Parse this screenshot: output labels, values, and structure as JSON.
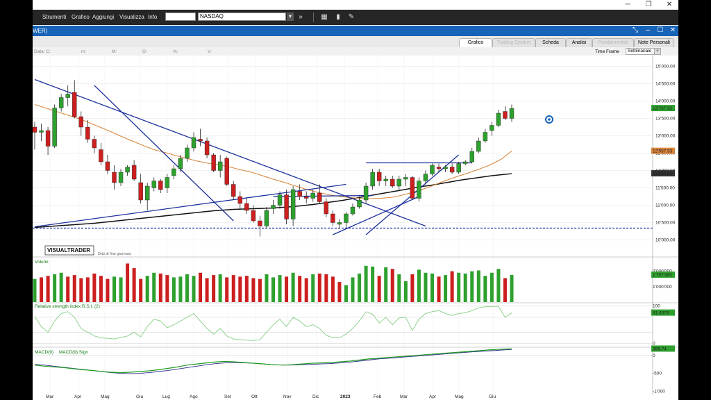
{
  "menubar": {
    "items": [
      "Strumenti",
      "Grafico",
      "Aggiungi",
      "Visualizza",
      "Info"
    ],
    "underline": [
      "S",
      "G",
      "A",
      "V",
      "I"
    ]
  },
  "toolbar": {
    "symbol": "NASDAQ",
    "icons": [
      "dropdown-arrow-icon",
      "fast-forward-icon",
      "grid-icon",
      "bar-chart-icon",
      "tools-icon"
    ]
  },
  "window": {
    "title_fragment": "WER)",
    "controls": [
      "resize-icon",
      "minimize-icon",
      "maximize-icon",
      "close-icon"
    ]
  },
  "tabs": [
    {
      "label": "Grafico",
      "state": "active"
    },
    {
      "label": "Trading System",
      "state": "disabled"
    },
    {
      "label": "Scheda",
      "state": "normal"
    },
    {
      "label": "Analisi",
      "state": "normal"
    },
    {
      "label": "Fondamentali",
      "state": "disabled"
    },
    {
      "label": "Note Personali",
      "state": "normal"
    }
  ],
  "info_row": {
    "labels": [
      "Data: C:",
      "m:",
      "M:",
      "O:",
      "%:",
      "V:"
    ],
    "timeframe_label": "Time Frame",
    "timeframe_value": "Settimanale"
  },
  "brand": {
    "logo": "VISUALTRADER",
    "note": "Dati di fine giornata"
  },
  "colors": {
    "up": "#2ea02e",
    "down": "#cc1f1f",
    "trendline": "#1c2f9c",
    "ma_short": "#d9853b",
    "ma_long": "#111111",
    "rsi": "#8fd28f",
    "accent_blue": "#1763b8"
  },
  "chart_data": [
    {
      "type": "candlestick",
      "name": "price",
      "x": [
        "Mar",
        "Apr",
        "Mag",
        "Giu",
        "Lug",
        "Ago",
        "Set",
        "Ott",
        "Nov",
        "Dic",
        "2023",
        "Feb",
        "Mar",
        "Apr",
        "Mag",
        "Giu"
      ],
      "yticks": [
        "15'000.00",
        "14'500.00",
        "14'000.00",
        "13'500.00",
        "13'000.00",
        "12'500.00",
        "12'000.00",
        "11'500.00",
        "11'000.00",
        "10'500.00",
        "10'000.00"
      ],
      "ylim": [
        9950,
        15150
      ],
      "last_label": "13'787.92",
      "ma_short_label": "12'557.53",
      "ma_long_label": "11'909.82",
      "support_level": 10340,
      "candles": [
        [
          13250,
          13400,
          12600,
          13100
        ],
        [
          13100,
          13350,
          12850,
          13150
        ],
        [
          13150,
          13250,
          12450,
          12700
        ],
        [
          12700,
          13900,
          12650,
          13800
        ],
        [
          13800,
          14200,
          13700,
          14100
        ],
        [
          14100,
          14450,
          13850,
          14200
        ],
        [
          14250,
          14600,
          13500,
          13550
        ],
        [
          13550,
          13700,
          13000,
          13250
        ],
        [
          13250,
          13450,
          12800,
          12900
        ],
        [
          12900,
          13000,
          12500,
          12650
        ],
        [
          12600,
          12800,
          12150,
          12250
        ],
        [
          12250,
          12450,
          11900,
          12000
        ],
        [
          11950,
          12150,
          11450,
          11650
        ],
        [
          11650,
          12050,
          11550,
          11950
        ],
        [
          11950,
          12150,
          11850,
          12100
        ],
        [
          12150,
          12300,
          11700,
          11750
        ],
        [
          11650,
          11900,
          11050,
          11150
        ],
        [
          11150,
          11650,
          10850,
          11550
        ],
        [
          11500,
          11800,
          11400,
          11700
        ],
        [
          11700,
          11750,
          11350,
          11450
        ],
        [
          11500,
          11900,
          11350,
          11800
        ],
        [
          11850,
          12150,
          11750,
          12050
        ],
        [
          12050,
          12450,
          11950,
          12350
        ],
        [
          12350,
          12750,
          12250,
          12650
        ],
        [
          12650,
          13100,
          12550,
          12950
        ],
        [
          12900,
          13200,
          12700,
          12850
        ],
        [
          12850,
          12950,
          12350,
          12450
        ],
        [
          12450,
          12500,
          11950,
          12000
        ],
        [
          12000,
          12450,
          11800,
          12250
        ],
        [
          12350,
          12400,
          11550,
          11600
        ],
        [
          11600,
          11700,
          11150,
          11250
        ],
        [
          11250,
          11400,
          10900,
          11050
        ],
        [
          11050,
          11200,
          10750,
          10850
        ],
        [
          10850,
          11000,
          10500,
          10550
        ],
        [
          10550,
          10700,
          10100,
          10400
        ],
        [
          10400,
          10950,
          10350,
          10850
        ],
        [
          10900,
          11150,
          10750,
          11000
        ],
        [
          11000,
          11400,
          10900,
          11300
        ],
        [
          11300,
          11450,
          10450,
          10600
        ],
        [
          10600,
          11550,
          10400,
          11450
        ],
        [
          11400,
          11600,
          11150,
          11250
        ],
        [
          11250,
          11400,
          11050,
          11200
        ],
        [
          11200,
          11450,
          11100,
          11350
        ],
        [
          11350,
          11600,
          11050,
          11100
        ],
        [
          11100,
          11200,
          10650,
          10750
        ],
        [
          10750,
          10850,
          10400,
          10500
        ],
        [
          10450,
          10600,
          10350,
          10500
        ],
        [
          10500,
          10800,
          10350,
          10750
        ],
        [
          10750,
          11050,
          10700,
          10950
        ],
        [
          10950,
          11250,
          10900,
          11150
        ],
        [
          11150,
          11650,
          11050,
          11550
        ],
        [
          11550,
          12050,
          11450,
          11950
        ],
        [
          11950,
          12050,
          11550,
          11700
        ],
        [
          11700,
          11850,
          11550,
          11750
        ],
        [
          11750,
          11850,
          11500,
          11550
        ],
        [
          11550,
          11850,
          11450,
          11750
        ],
        [
          11750,
          11900,
          11550,
          11800
        ],
        [
          11800,
          11850,
          11150,
          11200
        ],
        [
          11200,
          11800,
          11100,
          11700
        ],
        [
          11700,
          12000,
          11600,
          11900
        ],
        [
          11900,
          12200,
          11850,
          12150
        ],
        [
          12100,
          12200,
          11950,
          12050
        ],
        [
          12050,
          12150,
          11950,
          12100
        ],
        [
          12100,
          12200,
          11900,
          11950
        ],
        [
          11950,
          12250,
          11900,
          12200
        ],
        [
          12200,
          12300,
          12150,
          12250
        ],
        [
          12250,
          12650,
          12200,
          12550
        ],
        [
          12550,
          12950,
          12500,
          12850
        ],
        [
          12850,
          13200,
          12800,
          13100
        ],
        [
          13150,
          13400,
          13000,
          13300
        ],
        [
          13300,
          13750,
          13250,
          13650
        ],
        [
          13700,
          13850,
          13450,
          13500
        ],
        [
          13500,
          13900,
          13400,
          13788
        ]
      ],
      "ma_short": [
        13900,
        13800,
        13700,
        13600,
        13500,
        13380,
        13250,
        13120,
        12980,
        12850,
        12720,
        12600,
        12520,
        12430,
        12350,
        12270,
        12210,
        12160,
        12100,
        12020,
        11950,
        11850,
        11750,
        11660,
        11560,
        11460,
        11380,
        11310,
        11260,
        11220,
        11200,
        11190,
        11200,
        11230,
        11300,
        11380,
        11480,
        11600,
        11720,
        11830,
        11930,
        12040,
        12160,
        12320,
        12557
      ],
      "ma_long": [
        10360,
        10380,
        10400,
        10420,
        10440,
        10460,
        10480,
        10510,
        10540,
        10570,
        10600,
        10630,
        10660,
        10690,
        10720,
        10750,
        10780,
        10810,
        10840,
        10860,
        10880,
        10890,
        10900,
        10910,
        10920,
        10940,
        10960,
        10990,
        11020,
        11060,
        11100,
        11140,
        11190,
        11240,
        11290,
        11340,
        11390,
        11440,
        11490,
        11540,
        11580,
        11630,
        11680,
        11730,
        11770,
        11810,
        11850,
        11880,
        11909
      ]
    },
    {
      "type": "bar",
      "name": "Volumi",
      "ylim": [
        0,
        2700000
      ],
      "yticks": [
        "2'000'000",
        "1'000'000"
      ],
      "last_label": "1'757'300",
      "values": [
        1500000,
        1600000,
        1700000,
        1800000,
        1900000,
        1650000,
        1750000,
        1550000,
        1600000,
        1850000,
        1700000,
        1500000,
        1650000,
        1600000,
        2500000,
        2200000,
        1500000,
        1700000,
        1900000,
        1850000,
        1750000,
        1600000,
        1650000,
        1800000,
        1700000,
        1900000,
        1550000,
        1750000,
        1800000,
        1600000,
        1750000,
        1650000,
        1700000,
        1550000,
        1500000,
        1800000,
        1600000,
        1750000,
        1650000,
        1900000,
        1700000,
        1550000,
        1800000,
        1850000,
        1800000,
        1650000,
        1300000,
        1100000,
        1600000,
        1850000,
        2350000,
        2300000,
        1700000,
        2250000,
        2150000,
        1800000,
        1350000,
        1800000,
        2100000,
        1900000,
        1850000,
        1650000,
        1750000,
        2000000,
        1900000,
        1850000,
        2000000,
        2050000,
        1700000,
        1900000,
        2150000,
        1550000,
        1757300
      ],
      "colors_up": [
        1,
        0,
        0,
        1,
        1,
        0,
        0,
        0,
        0,
        0,
        0,
        0,
        1,
        1,
        0,
        0,
        0,
        1,
        1,
        0,
        0,
        1,
        1,
        1,
        1,
        0,
        0,
        0,
        1,
        0,
        0,
        0,
        0,
        0,
        0,
        1,
        1,
        1,
        0,
        1,
        0,
        0,
        1,
        0,
        0,
        0,
        0,
        1,
        1,
        1,
        1,
        1,
        0,
        1,
        0,
        1,
        1,
        0,
        1,
        1,
        1,
        0,
        1,
        0,
        1,
        1,
        1,
        1,
        1,
        1,
        1,
        0,
        1
      ]
    },
    {
      "type": "line",
      "name": "Relative strength index R.S.I. (2)",
      "ylim": [
        -10,
        105
      ],
      "yticks": [
        "100",
        "0",
        "-0"
      ],
      "last_label": "81.6378",
      "values": [
        72,
        45,
        30,
        60,
        80,
        85,
        70,
        40,
        30,
        20,
        15,
        14,
        12,
        16,
        20,
        30,
        18,
        45,
        65,
        60,
        42,
        50,
        60,
        70,
        80,
        60,
        40,
        25,
        40,
        20,
        12,
        10,
        9,
        8,
        10,
        30,
        50,
        65,
        45,
        70,
        60,
        45,
        50,
        40,
        22,
        15,
        15,
        25,
        40,
        60,
        85,
        78,
        55,
        70,
        50,
        68,
        70,
        35,
        65,
        80,
        85,
        88,
        80,
        75,
        80,
        82,
        88,
        95,
        98,
        99,
        99,
        70,
        81.64
      ]
    },
    {
      "type": "line",
      "name": "MACD(9)",
      "ylim": [
        -1050,
        150
      ],
      "yticks": [
        "0",
        "-500",
        "-1'000"
      ],
      "last_label": "386.74",
      "series": [
        {
          "name": "MACD(9)",
          "values": [
            -270,
            -300,
            -320,
            -340,
            -370,
            -400,
            -420,
            -450,
            -470,
            -480,
            -470,
            -450,
            -430,
            -400,
            -360,
            -320,
            -270,
            -240,
            -210,
            -180,
            -170,
            -180,
            -200,
            -220,
            -240,
            -260,
            -270,
            -260,
            -240,
            -220,
            -210,
            -200,
            -180,
            -160,
            -130,
            -100,
            -80,
            -60,
            -40,
            -20,
            0,
            20,
            40,
            60,
            80,
            100,
            120,
            140,
            160,
            175,
            180
          ]
        },
        {
          "name": "MACD(9) Sign",
          "values": [
            -250,
            -270,
            -300,
            -330,
            -360,
            -390,
            -420,
            -450,
            -480,
            -500,
            -510,
            -500,
            -480,
            -450,
            -420,
            -380,
            -340,
            -300,
            -260,
            -230,
            -210,
            -200,
            -210,
            -220,
            -240,
            -260,
            -270,
            -270,
            -260,
            -250,
            -240,
            -230,
            -210,
            -190,
            -160,
            -130,
            -100,
            -80,
            -60,
            -40,
            -20,
            0,
            20,
            40,
            60,
            80,
            100,
            115,
            130,
            150,
            165
          ]
        }
      ]
    }
  ],
  "xaxis_labels": [
    "Mar",
    "Apr",
    "Mag",
    "Giu",
    "Lug",
    "Ago",
    "Set",
    "Ott",
    "Nov",
    "Dic",
    "2023",
    "Feb",
    "Mar",
    "Apr",
    "Mag",
    "Giu"
  ]
}
